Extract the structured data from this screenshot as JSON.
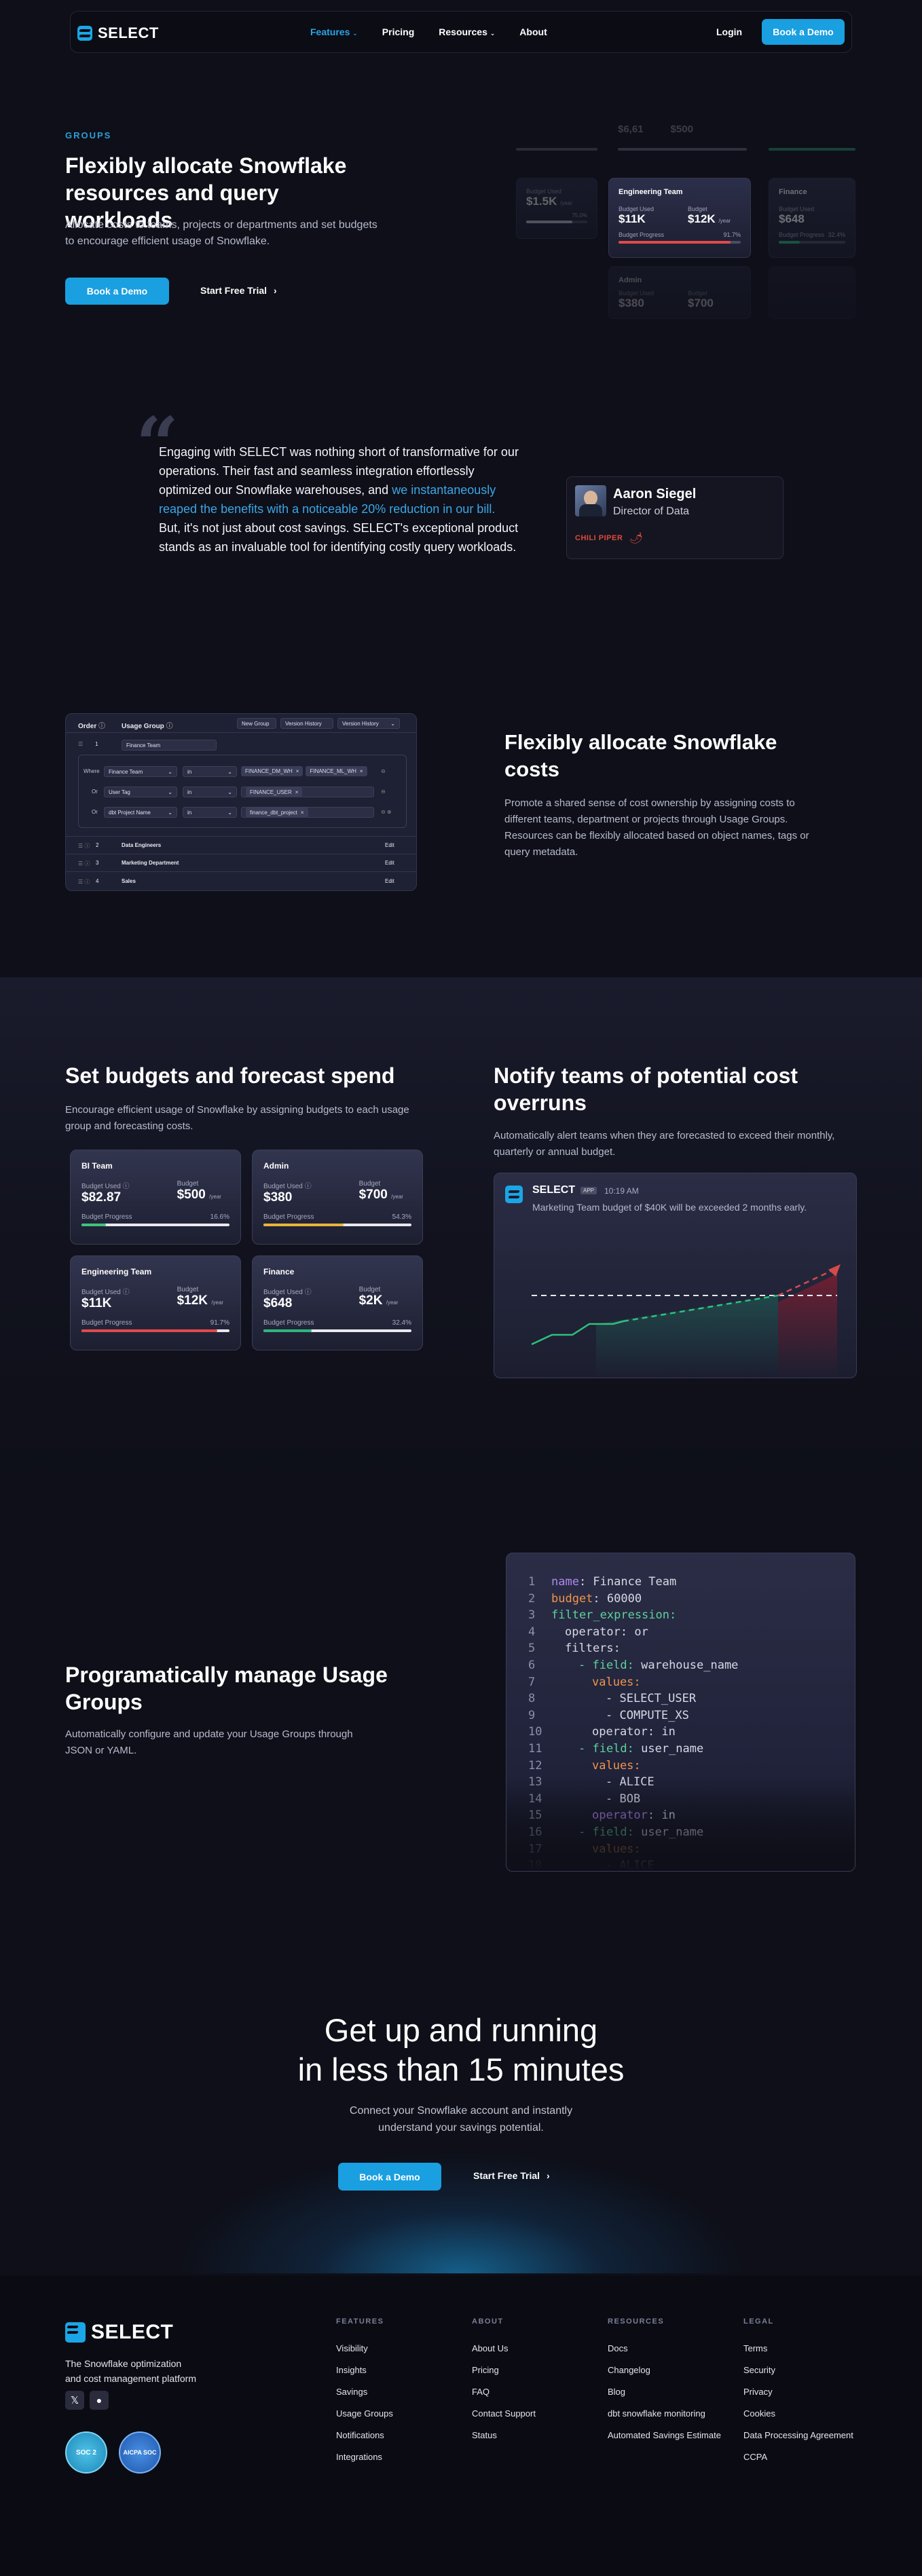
{
  "nav": {
    "brand": "SELECT",
    "links": [
      {
        "label": "Features",
        "active": true,
        "caret": true
      },
      {
        "label": "Pricing",
        "active": false,
        "caret": false
      },
      {
        "label": "Resources",
        "active": false,
        "caret": true
      },
      {
        "label": "About",
        "active": false,
        "caret": false
      }
    ],
    "login": "Login",
    "book_demo": "Book a Demo"
  },
  "hero": {
    "eyebrow": "GROUPS",
    "title": "Flexibly allocate Snowflake resources and query workloads",
    "desc": "Allocate costs to teams, projects or departments and set budgets to encourage efficient usage of Snowflake.",
    "cta_primary": "Book a Demo",
    "cta_secondary": "Start Free Trial",
    "mini_cards": {
      "top_faded": [
        "$6,61",
        "$500"
      ],
      "left": {
        "used_label": "Budget Used",
        "used": "$1.5K",
        "unit": "/year",
        "pct": "75.0%"
      },
      "center": {
        "title": "Engineering Team",
        "used_label": "Budget Used",
        "budget_label": "Budget",
        "used": "$11K",
        "budget": "$12K",
        "unit": "/year",
        "progress_label": "Budget Progress",
        "pct": "91.7%",
        "fill": 0.917
      },
      "right": {
        "title": "Finance",
        "used_label": "Budget Used",
        "used": "$648",
        "progress_label": "Budget Progress",
        "pct": "32.4%"
      },
      "bottom": {
        "title": "Admin",
        "used_label": "Budget Used",
        "budget_label": "Budget",
        "used": "$380",
        "budget": "$700"
      }
    }
  },
  "testimonial": {
    "quote_start": "Engaging with SELECT was nothing short of transformative for our operations. Their fast and seamless integration effortlessly optimized our Snowflake warehouses, and ",
    "quote_highlight": "we instantaneously reaped the benefits with a noticeable 20% reduction in our bill.",
    "quote_end": " But, it's not just about cost savings. SELECT's exceptional product stands as an invaluable tool for identifying costly query workloads.",
    "name": "Aaron Siegel",
    "role": "Director of Data",
    "company": "CHILI PIPER"
  },
  "allocate": {
    "title": "Flexibly allocate Snowflake costs",
    "desc": "Promote a shared sense of cost ownership by assigning costs to different teams, department or projects through Usage Groups. Resources can be flexibly allocated based on object names, tags or query metadata.",
    "builder": {
      "order_label": "Order",
      "group_label": "Usage Group",
      "btn_new": "New Group",
      "btn_history": "Version History",
      "btn_history2": "Version History",
      "row1_num": "1",
      "row1_name": "Finance Team",
      "where": "Where",
      "or": "Or",
      "conds": [
        {
          "field": "Finance Team",
          "op": "in",
          "chips": [
            "FINANCE_DM_WH",
            "FINANCE_ML_WH"
          ]
        },
        {
          "field": "User Tag",
          "op": "in",
          "chips": [
            "FINANCE_USER"
          ]
        },
        {
          "field": "dbt Project Name",
          "op": "in",
          "chips": [
            "finance_dbt_project"
          ]
        }
      ],
      "groups": [
        {
          "num": "2",
          "name": "Data Engineers",
          "edit": "Edit"
        },
        {
          "num": "3",
          "name": "Marketing Department",
          "edit": "Edit"
        },
        {
          "num": "4",
          "name": "Sales",
          "edit": "Edit"
        }
      ]
    }
  },
  "budgets": {
    "title": "Set budgets and forecast spend",
    "desc": "Encourage efficient usage of Snowflake by assigning budgets to each usage group and forecasting costs.",
    "used_label": "Budget Used",
    "budget_label": "Budget",
    "progress_label": "Budget Progress",
    "cards": [
      {
        "title": "BI Team",
        "used": "$82.87",
        "budget": "$500",
        "unit": "/year",
        "pct": "16.6%",
        "fill": 0.166,
        "color": "#3fc37a"
      },
      {
        "title": "Admin",
        "used": "$380",
        "budget": "$700",
        "unit": "/year",
        "pct": "54.3%",
        "fill": 0.543,
        "color": "#e6b53a"
      },
      {
        "title": "Engineering Team",
        "used": "$11K",
        "budget": "$12K",
        "unit": "/year",
        "pct": "91.7%",
        "fill": 0.917,
        "color": "#e04a4a"
      },
      {
        "title": "Finance",
        "used": "$648",
        "budget": "$2K",
        "unit": "/year",
        "pct": "32.4%",
        "fill": 0.324,
        "color": "#2eb67d"
      }
    ]
  },
  "notify": {
    "title": "Notify teams of potential cost overruns",
    "desc": "Automatically alert teams when they are forecasted to exceed their monthly, quarterly or annual budget.",
    "app": "SELECT",
    "app_badge": "APP",
    "time": "10:19 AM",
    "message": "Marketing Team budget of $40K will be exceeded 2 months early."
  },
  "api": {
    "title": "Programatically manage Usage Groups",
    "desc": "Automatically configure and update your Usage Groups through JSON or YAML.",
    "lines": [
      {
        "n": "1",
        "k": "name",
        "kc": "p",
        "v": ": Finance Team",
        "indent": 0
      },
      {
        "n": "2",
        "k": "budget",
        "kc": "o",
        "v": ": 60000",
        "indent": 0
      },
      {
        "n": "3",
        "k": "filter_expression:",
        "kc": "g",
        "v": "",
        "indent": 0
      },
      {
        "n": "4",
        "k": "",
        "kc": "w",
        "v": "operator: or",
        "indent": 1
      },
      {
        "n": "5",
        "k": "",
        "kc": "w",
        "v": "filters:",
        "indent": 1
      },
      {
        "n": "6",
        "k": "- field:",
        "kc": "g",
        "v": " warehouse_name",
        "indent": 2
      },
      {
        "n": "7",
        "k": "values:",
        "kc": "o",
        "v": "",
        "indent": 3
      },
      {
        "n": "8",
        "k": "",
        "kc": "w",
        "v": "- SELECT_USER",
        "indent": 4
      },
      {
        "n": "9",
        "k": "",
        "kc": "w",
        "v": "- COMPUTE_XS",
        "indent": 4
      },
      {
        "n": "10",
        "k": "",
        "kc": "w",
        "v": "operator: in",
        "indent": 3
      },
      {
        "n": "11",
        "k": "- field:",
        "kc": "g",
        "v": " user_name",
        "indent": 2
      },
      {
        "n": "12",
        "k": "values:",
        "kc": "o",
        "v": "",
        "indent": 3
      },
      {
        "n": "13",
        "k": "",
        "kc": "w",
        "v": "- ALICE",
        "indent": 4
      },
      {
        "n": "14",
        "k": "",
        "kc": "w",
        "v": "- BOB",
        "indent": 4
      },
      {
        "n": "15",
        "k": "operator",
        "kc": "p",
        "v": ": in",
        "indent": 3
      },
      {
        "n": "16",
        "k": "- field:",
        "kc": "g",
        "v": " user_name",
        "indent": 2
      },
      {
        "n": "17",
        "k": "values:",
        "kc": "o",
        "v": "",
        "indent": 3
      },
      {
        "n": "18",
        "k": "",
        "kc": "w",
        "v": "- ALICE",
        "indent": 4
      }
    ]
  },
  "cta": {
    "title_1": "Get up and running",
    "title_2": "in less than 15 minutes",
    "desc_1": "Connect your Snowflake account and instantly",
    "desc_2": "understand your savings potential.",
    "primary": "Book a Demo",
    "secondary": "Start Free Trial"
  },
  "footer": {
    "brand": "SELECT",
    "tagline_1": "The Snowflake optimization",
    "tagline_2": "and cost management platform",
    "cols": [
      {
        "head": "FEATURES",
        "links": [
          "Visibility",
          "Insights",
          "Savings",
          "Usage Groups",
          "Notifications",
          "Integrations"
        ]
      },
      {
        "head": "ABOUT",
        "links": [
          "About Us",
          "Pricing",
          "FAQ",
          "Contact Support",
          "Status"
        ]
      },
      {
        "head": "RESOURCES",
        "links": [
          "Docs",
          "Changelog",
          "Blog",
          "dbt snowflake monitoring",
          "Automated Savings Estimate"
        ]
      },
      {
        "head": "LEGAL",
        "links": [
          "Terms",
          "Security",
          "Privacy",
          "Cookies",
          "Data Processing Agreement",
          "CCPA"
        ]
      }
    ],
    "badge1": "SOC 2",
    "badge2": "AICPA SOC"
  }
}
